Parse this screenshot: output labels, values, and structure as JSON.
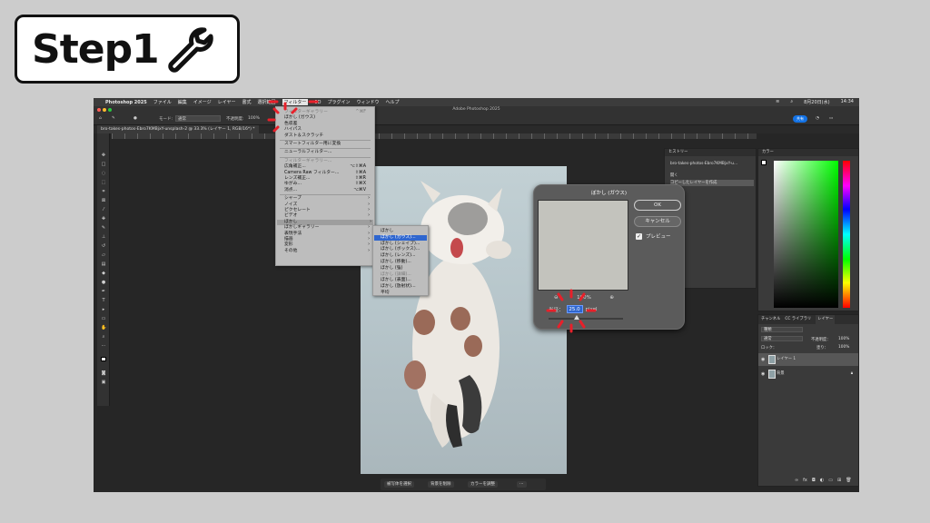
{
  "badge": {
    "text": "Step1",
    "icon": "wrench-icon"
  },
  "menubar": {
    "app": "Photoshop 2025",
    "items": [
      "ファイル",
      "編集",
      "イメージ",
      "レイヤー",
      "書式",
      "選択範囲",
      "フィルター",
      "3D",
      "プラグイン",
      "ウィンドウ",
      "ヘルプ"
    ],
    "active_item": "フィルター",
    "date": "8月20日(水)",
    "time": "14:34"
  },
  "window_title": "Adobe Photoshop 2025",
  "options": {
    "mode_label": "モード:",
    "mode_value": "通常",
    "opacity_label": "不透明度:",
    "opacity_value": "100%",
    "share_label": "共有"
  },
  "document_tab": "bro-takes-photos-Ebro7KMBjxY-unsplash-2 @ 33.3% (レイヤー 1, RGB/16*) *",
  "filter_menu": {
    "items": [
      {
        "label": "フィルターギャラリー",
        "shortcut": "^⌘F",
        "disabled": true
      },
      {
        "label": "ぼかし (ガウス)",
        "disabled": false
      },
      {
        "label": "色収差",
        "disabled": false
      },
      {
        "label": "ハイパス",
        "disabled": false
      },
      {
        "label": "ダスト＆スクラッチ",
        "disabled": false
      },
      {
        "sep": true
      },
      {
        "label": "スマートフィルター用に変換"
      },
      {
        "sep": true
      },
      {
        "label": "ニューラルフィルター..."
      },
      {
        "sep": true
      },
      {
        "label": "フィルターギャラリー...",
        "disabled": true
      },
      {
        "label": "広角補正...",
        "shortcut": "⌥⇧⌘A"
      },
      {
        "label": "Camera Raw フィルター...",
        "shortcut": "⇧⌘A"
      },
      {
        "label": "レンズ補正...",
        "shortcut": "⇧⌘R"
      },
      {
        "label": "ゆがみ...",
        "shortcut": "⇧⌘X"
      },
      {
        "label": "消点...",
        "shortcut": "⌥⌘V"
      },
      {
        "sep": true
      },
      {
        "label": "シャープ",
        "arrow": true
      },
      {
        "label": "ノイズ",
        "arrow": true
      },
      {
        "label": "ピクセレート",
        "arrow": true
      },
      {
        "label": "ビデオ",
        "arrow": true
      },
      {
        "label": "ぼかし",
        "arrow": true,
        "highlight": true
      },
      {
        "label": "ぼかしギャラリー",
        "arrow": true
      },
      {
        "label": "表現手法",
        "arrow": true
      },
      {
        "label": "描画",
        "arrow": true
      },
      {
        "label": "変形",
        "arrow": true
      },
      {
        "label": "その他",
        "arrow": true
      }
    ]
  },
  "blur_submenu": {
    "items": [
      {
        "label": "ぼかし"
      },
      {
        "label": "ぼかし (ガウス)...",
        "selected": true
      },
      {
        "label": "ぼかし (シェイプ)..."
      },
      {
        "label": "ぼかし (ボックス)..."
      },
      {
        "label": "ぼかし (レンズ)..."
      },
      {
        "label": "ぼかし (移動)..."
      },
      {
        "label": "ぼかし (強)"
      },
      {
        "label": "ぼかし (詳細)...",
        "disabled": true
      },
      {
        "label": "ぼかし (表面)..."
      },
      {
        "label": "ぼかし (放射状)..."
      },
      {
        "label": "平均"
      }
    ]
  },
  "gaussian_dialog": {
    "title": "ぼかし (ガウス)",
    "ok": "OK",
    "cancel": "キャンセル",
    "preview_label": "プレビュー",
    "preview_checked": true,
    "zoom": "100%",
    "radius_label": "半径：",
    "radius_value": "25.0",
    "unit": "pixel"
  },
  "history_panel": {
    "tab": "ヒストリー",
    "snapshot": "bro-takes-photos-Ebro7KMBjxY-u...",
    "rows": [
      "開く",
      "コピーしたレイヤーを作成"
    ]
  },
  "color_panel": {
    "tab": "カラー"
  },
  "layers_panel": {
    "tabs": [
      "チャンネル",
      "CC ライブラリ",
      "レイヤー"
    ],
    "filter": "種類",
    "blend": "通常",
    "opacity_label": "不透明度：",
    "opacity_value": "100%",
    "lock_label": "ロック：",
    "fill_label": "塗り：",
    "fill_value": "100%",
    "layers": [
      {
        "name": "レイヤー 1",
        "selected": true
      },
      {
        "name": "背景",
        "selected": false
      }
    ]
  },
  "bottom_bar": [
    "被写体を選択",
    "背景を削除",
    "カラーを調整"
  ],
  "colors": {
    "accent": "#1473e6",
    "selection": "#2f66cf",
    "flash": "#e8202a"
  }
}
